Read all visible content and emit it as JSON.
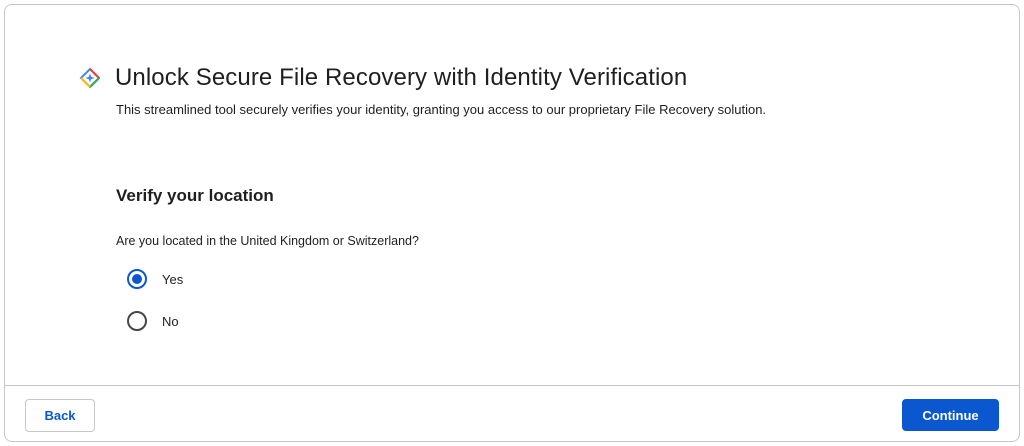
{
  "header": {
    "logo_icon": "sparkle-diamond-icon",
    "title": "Unlock Secure File Recovery with Identity Verification",
    "description": "This streamlined tool securely verifies your identity, granting you access to our proprietary File Recovery solution."
  },
  "section": {
    "title": "Verify your location",
    "question": "Are you located in the United Kingdom or Switzerland?",
    "options": [
      {
        "label": "Yes",
        "selected": true
      },
      {
        "label": "No",
        "selected": false
      }
    ]
  },
  "footer": {
    "back_label": "Back",
    "continue_label": "Continue"
  },
  "colors": {
    "accent": "#0b57d0",
    "border": "#c7c7c7",
    "text": "#1f1f1f"
  }
}
